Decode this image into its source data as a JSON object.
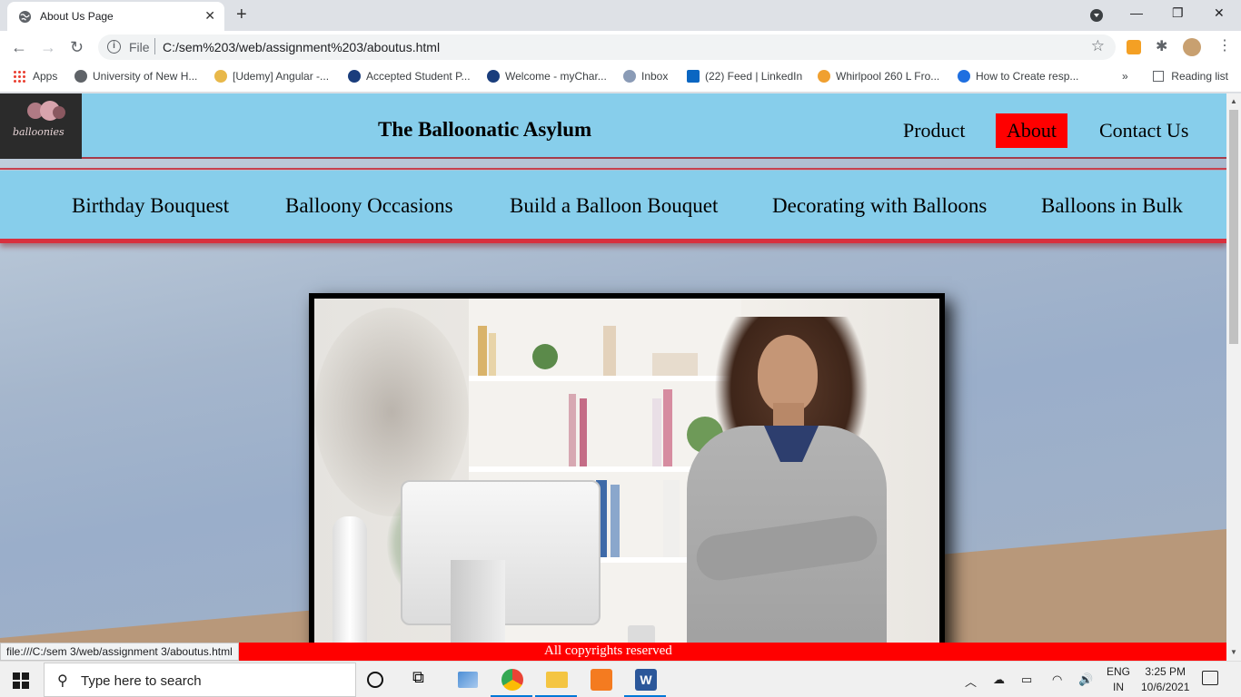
{
  "browser": {
    "tab_title": "About Us Page",
    "tab_close": "✕",
    "new_tab": "+",
    "omnibox_scheme": "File",
    "omnibox_url": "C:/sem%203/web/assignment%203/aboutus.html",
    "reading_list": "Reading list",
    "overflow": "»",
    "status_url": "file:///C:/sem 3/web/assignment 3/aboutus.html"
  },
  "bookmarks": [
    "Apps",
    "University of New H...",
    "[Udemy] Angular -...",
    "Accepted Student P...",
    "Welcome - myChar...",
    "Inbox",
    "(22) Feed | LinkedIn",
    "Whirlpool 260 L Fro...",
    "How to Create resp..."
  ],
  "site": {
    "title": "The Balloonatic Asylum",
    "logo_text": "balloonies",
    "nav": {
      "product": "Product",
      "about": "About",
      "contact": "Contact Us"
    },
    "subnav": [
      "Birthday Bouquest",
      "Balloony Occasions",
      "Build a Balloon Bouquet",
      "Decorating with Balloons",
      "Balloons in Bulk"
    ],
    "footer": "All copyrights reserved"
  },
  "taskbar": {
    "search_placeholder": "Type here to search",
    "lang_top": "ENG",
    "lang_bottom": "IN",
    "time": "3:25 PM",
    "date": "10/6/2021"
  },
  "colors": {
    "header_bg": "#87ceeb",
    "active_nav": "#ff0000",
    "footer_bg": "#ff0000",
    "accent_line": "#d8303e"
  }
}
